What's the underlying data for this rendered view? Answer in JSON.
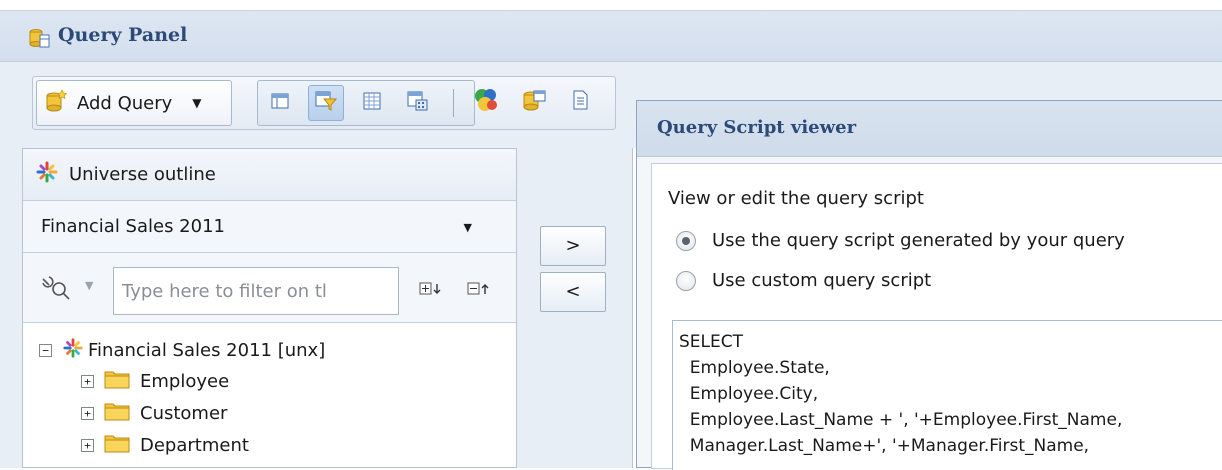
{
  "window": {
    "title": "Query Panel"
  },
  "toolbar": {
    "add_query_label": "Add Query",
    "buttons": [
      "result-objects-icon",
      "query-filters-icon",
      "data-preview-icon",
      "query-properties-icon",
      "combined-query-icon",
      "query-settings-icon",
      "view-script-icon"
    ]
  },
  "universe": {
    "header_label": "Universe outline",
    "selected_universe": "Financial Sales 2011",
    "filter_placeholder": "Type here to filter on tl",
    "tree": [
      {
        "label": "Financial Sales 2011 [unx]",
        "expander": "−"
      },
      {
        "label": "Employee",
        "expander": "+"
      },
      {
        "label": "Customer",
        "expander": "+"
      },
      {
        "label": "Department",
        "expander": "+"
      }
    ]
  },
  "arrows": {
    "add": ">",
    "remove": "<"
  },
  "dialog": {
    "title": "Query Script viewer",
    "instruction": "View or edit the query script",
    "options": [
      {
        "label": "Use the query script generated by your query",
        "selected": true
      },
      {
        "label": "Use custom query script",
        "selected": false
      }
    ],
    "script": "SELECT\n  Employee.State,\n  Employee.City,\n  Employee.Last_Name + ', '+Employee.First_Name,\n  Manager.Last_Name+', '+Manager.First_Name,"
  }
}
